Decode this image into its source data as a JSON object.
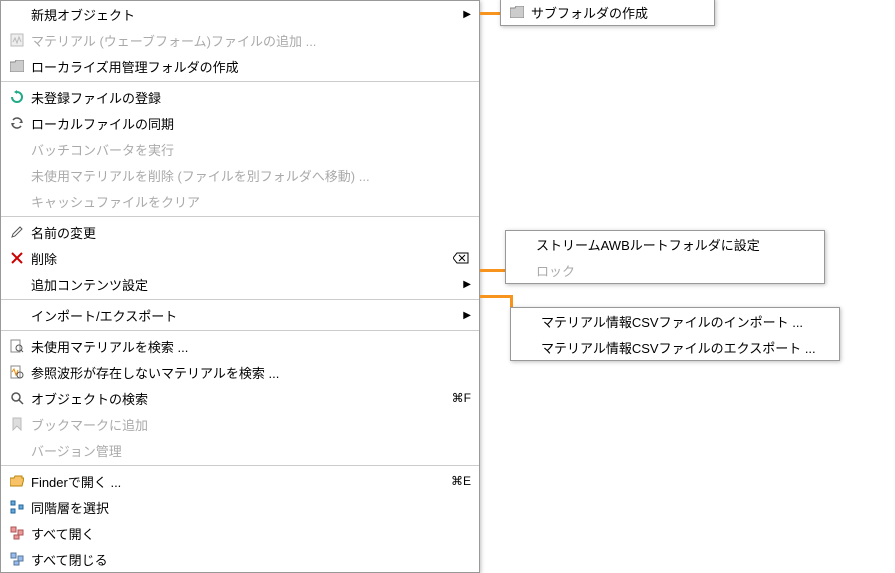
{
  "main": {
    "new_object": "新規オブジェクト",
    "add_material": "マテリアル (ウェーブフォーム)ファイルの追加 ...",
    "create_loc_folder": "ローカライズ用管理フォルダの作成",
    "register_files": "未登録ファイルの登録",
    "sync_local": "ローカルファイルの同期",
    "batch_converter": "バッチコンバータを実行",
    "del_unused": "未使用マテリアルを削除 (ファイルを別フォルダへ移動) ...",
    "clear_cache": "キャッシュファイルをクリア",
    "rename": "名前の変更",
    "delete": "削除",
    "addl_content": "追加コンテンツ設定",
    "import_export": "インポート/エクスポート",
    "find_unused": "未使用マテリアルを検索 ...",
    "find_missing_ref": "参照波形が存在しないマテリアルを検索 ...",
    "find_obj": "オブジェクトの検索",
    "bookmark": "ブックマークに追加",
    "version": "バージョン管理",
    "open_finder": "Finderで開く ...",
    "select_level": "同階層を選択",
    "expand_all": "すべて開く",
    "collapse_all": "すべて閉じる",
    "sc_find": "⌘F",
    "sc_finder": "⌘E"
  },
  "sub_new": {
    "subfolder": "サブフォルダの作成"
  },
  "sub_addl": {
    "stream_root": "ストリームAWBルートフォルダに設定",
    "lock": "ロック"
  },
  "sub_io": {
    "csv_import": "マテリアル情報CSVファイルのインポート ...",
    "csv_export": "マテリアル情報CSVファイルのエクスポート ..."
  }
}
